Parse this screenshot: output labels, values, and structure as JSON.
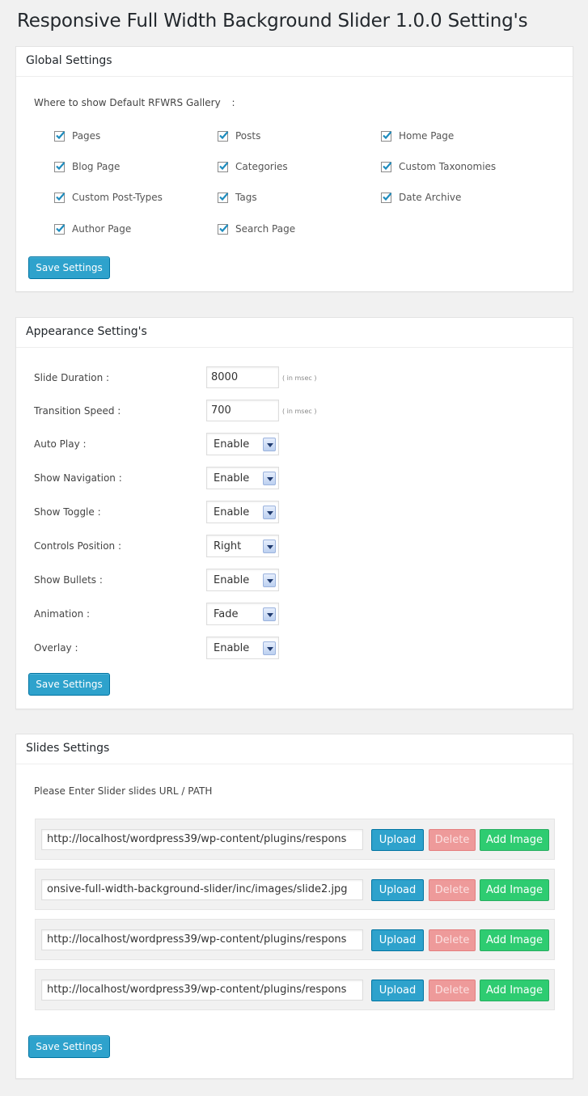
{
  "page": {
    "title": "Responsive Full Width Background Slider 1.0.0 Setting's"
  },
  "global": {
    "heading": "Global Settings",
    "where_label": "Where to show Default RFWRS Gallery",
    "where_colon": ":",
    "checkboxes": [
      {
        "label": "Pages",
        "checked": true
      },
      {
        "label": "Posts",
        "checked": true
      },
      {
        "label": "Home Page",
        "checked": true
      },
      {
        "label": "Blog Page",
        "checked": true
      },
      {
        "label": "Categories",
        "checked": true
      },
      {
        "label": "Custom Taxonomies",
        "checked": true
      },
      {
        "label": "Custom Post-Types",
        "checked": true
      },
      {
        "label": "Tags",
        "checked": true
      },
      {
        "label": "Date Archive",
        "checked": true
      },
      {
        "label": "Author Page",
        "checked": true
      },
      {
        "label": "Search Page",
        "checked": true
      }
    ],
    "save_label": "Save Settings"
  },
  "appearance": {
    "heading": "Appearance Setting's",
    "slide_duration": {
      "label": "Slide Duration :",
      "value": "8000",
      "hint": "( in msec )"
    },
    "transition_speed": {
      "label": "Transition Speed :",
      "value": "700",
      "hint": "( in msec )"
    },
    "selects": [
      {
        "label": "Auto Play :",
        "value": "Enable"
      },
      {
        "label": "Show Navigation :",
        "value": "Enable"
      },
      {
        "label": "Show Toggle :",
        "value": "Enable"
      },
      {
        "label": "Controls Position :",
        "value": "Right"
      },
      {
        "label": "Show Bullets :",
        "value": "Enable"
      },
      {
        "label": "Animation :",
        "value": "Fade"
      },
      {
        "label": "Overlay :",
        "value": "Enable"
      }
    ],
    "save_label": "Save Settings"
  },
  "slides": {
    "heading": "Slides Settings",
    "intro": "Please Enter Slider slides URL / PATH",
    "rows": [
      {
        "url": "http://localhost/wordpress39/wp-content/plugins/respons"
      },
      {
        "url": "onsive-full-width-background-slider/inc/images/slide2.jpg"
      },
      {
        "url": "http://localhost/wordpress39/wp-content/plugins/respons"
      },
      {
        "url": "http://localhost/wordpress39/wp-content/plugins/respons"
      }
    ],
    "upload_label": "Upload",
    "delete_label": "Delete",
    "add_label": "Add Image",
    "save_label": "Save Settings"
  },
  "colors": {
    "primary": "#2ea2cc",
    "delete": "#ee9a9a",
    "add": "#2ecc71",
    "check": "#1e8cbe"
  }
}
